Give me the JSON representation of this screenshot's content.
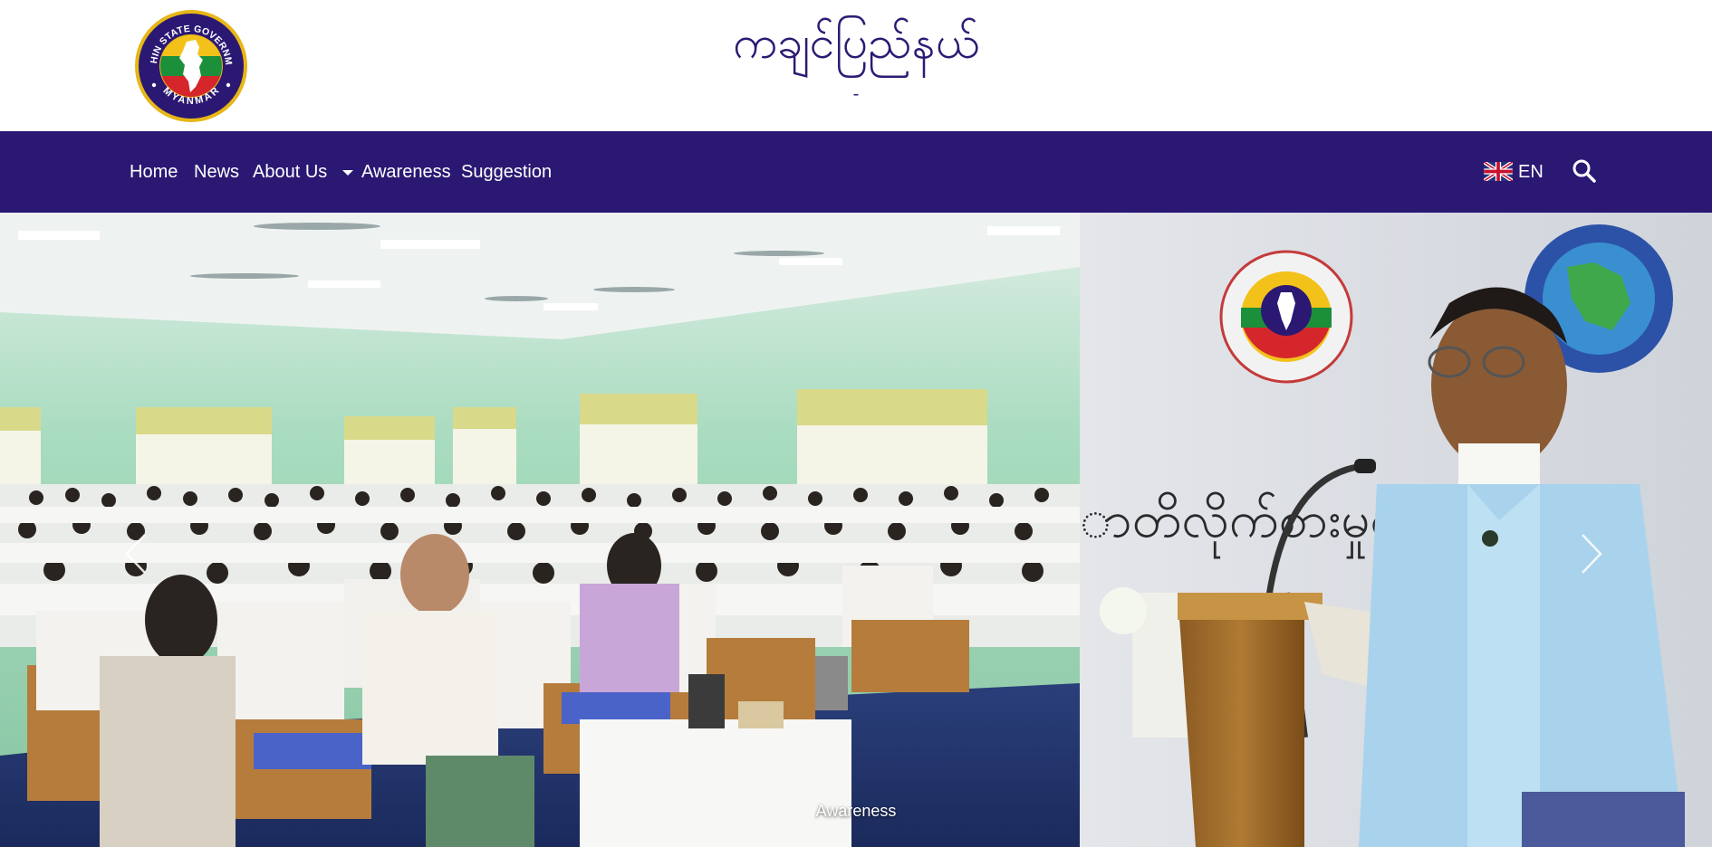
{
  "header": {
    "logo": {
      "top_text": "KACHIN STATE GOVERNMENT",
      "bottom_text": "MYANMAR",
      "ring_color": "#2b1873",
      "rim_color": "#e7b617"
    },
    "title": "ကချင်ပြည်နယ်",
    "subtitle": "-"
  },
  "nav": {
    "background": "#2b1873",
    "items": [
      {
        "label": "Home"
      },
      {
        "label": "News"
      },
      {
        "label": "About Us",
        "dropdown": true
      },
      {
        "label": "Awareness"
      },
      {
        "label": "Suggestion"
      }
    ],
    "language": {
      "label": "EN",
      "icon": "uk-flag-icon"
    },
    "search_icon": "search-icon"
  },
  "carousel": {
    "caption": "Awareness",
    "prev_icon": "chevron-left-icon",
    "next_icon": "chevron-right-icon",
    "sign_text": "ာတိလိုက်စားမှုတိုက်ဖ"
  }
}
